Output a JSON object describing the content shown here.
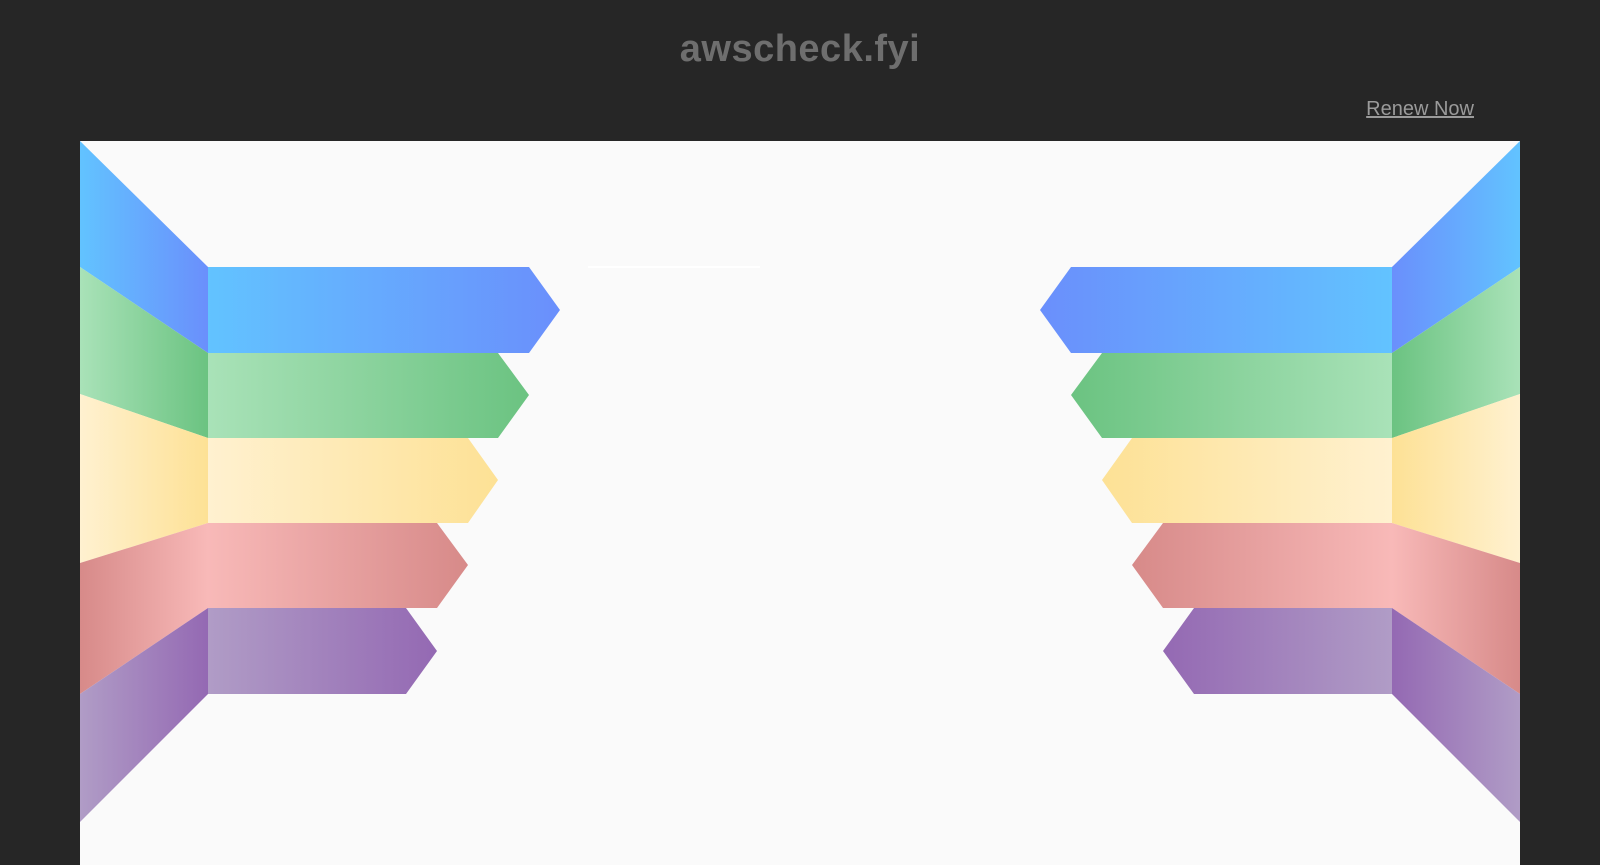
{
  "header": {
    "site_title": "awscheck.fyi",
    "renew_label": "Renew Now"
  },
  "colors": {
    "background": "#262626",
    "panel": "#fafafa",
    "title_text": "#6e6e6e",
    "link_text": "#9a9a9a",
    "stripes": [
      {
        "name": "blue",
        "light": "#62c3ff",
        "dark": "#6a8ffc"
      },
      {
        "name": "green",
        "light": "#a9e2b8",
        "dark": "#6bc381"
      },
      {
        "name": "yellow",
        "light": "#fff1d0",
        "dark": "#fde195"
      },
      {
        "name": "red",
        "light": "#f8b9b8",
        "dark": "#d78a89"
      },
      {
        "name": "purple",
        "light": "#b09cc6",
        "dark": "#9469b3"
      }
    ]
  }
}
